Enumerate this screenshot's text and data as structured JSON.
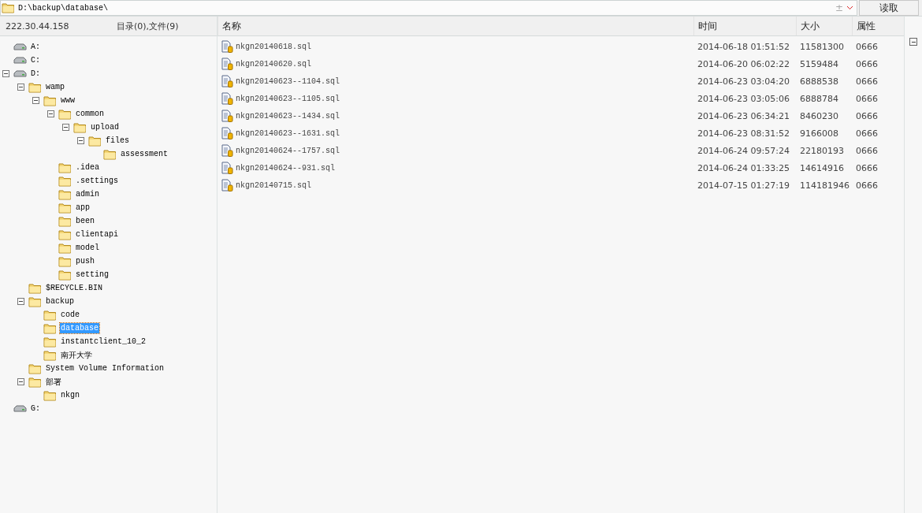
{
  "path_bar": {
    "value": "D:\\backup\\database\\",
    "plus": "±",
    "button": "读取"
  },
  "tree_header": {
    "host": "222.30.44.158",
    "counts": "目录(0),文件(9)"
  },
  "tree": [
    {
      "label": "A:",
      "kind": "drive",
      "selected": false
    },
    {
      "label": "C:",
      "kind": "drive",
      "selected": false
    },
    {
      "label": "D:",
      "kind": "drive",
      "selected": false,
      "expanded": true,
      "children": [
        {
          "label": "wamp",
          "kind": "folder",
          "selected": false,
          "expanded": true,
          "children": [
            {
              "label": "www",
              "kind": "folder",
              "selected": false,
              "expanded": true,
              "children": [
                {
                  "label": "common",
                  "kind": "folder",
                  "selected": false,
                  "expanded": true,
                  "children": [
                    {
                      "label": "upload",
                      "kind": "folder",
                      "selected": false,
                      "expanded": true,
                      "children": [
                        {
                          "label": "files",
                          "kind": "folder",
                          "selected": false,
                          "expanded": true,
                          "children": [
                            {
                              "label": "assessment",
                              "kind": "folder",
                              "selected": false
                            }
                          ]
                        }
                      ]
                    }
                  ]
                },
                {
                  "label": ".idea",
                  "kind": "folder",
                  "selected": false
                },
                {
                  "label": ".settings",
                  "kind": "folder",
                  "selected": false
                },
                {
                  "label": "admin",
                  "kind": "folder",
                  "selected": false
                },
                {
                  "label": "app",
                  "kind": "folder",
                  "selected": false
                },
                {
                  "label": "been",
                  "kind": "folder",
                  "selected": false
                },
                {
                  "label": "clientapi",
                  "kind": "folder",
                  "selected": false
                },
                {
                  "label": "model",
                  "kind": "folder",
                  "selected": false
                },
                {
                  "label": "push",
                  "kind": "folder",
                  "selected": false
                },
                {
                  "label": "setting",
                  "kind": "folder",
                  "selected": false
                }
              ]
            }
          ]
        },
        {
          "label": "$RECYCLE.BIN",
          "kind": "folder",
          "selected": false
        },
        {
          "label": "backup",
          "kind": "folder",
          "selected": false,
          "expanded": true,
          "children": [
            {
              "label": "code",
              "kind": "folder",
              "selected": false
            },
            {
              "label": "database",
              "kind": "folder",
              "selected": true
            },
            {
              "label": "instantclient_10_2",
              "kind": "folder",
              "selected": false
            },
            {
              "label": "南开大学",
              "kind": "folder",
              "selected": false
            }
          ]
        },
        {
          "label": "System Volume Information",
          "kind": "folder",
          "selected": false
        },
        {
          "label": "部署",
          "kind": "folder",
          "selected": false,
          "expanded": true,
          "children": [
            {
              "label": "nkgn",
              "kind": "folder",
              "selected": false
            }
          ]
        }
      ]
    },
    {
      "label": "G:",
      "kind": "drive",
      "selected": false
    }
  ],
  "table": {
    "columns": [
      "名称",
      "时间",
      "大小",
      "属性"
    ],
    "rows": [
      [
        "nkgn20140618.sql",
        "2014-06-18 01:51:52",
        "11581300",
        "0666"
      ],
      [
        "nkgn20140620.sql",
        "2014-06-20 06:02:22",
        "5159484",
        "0666"
      ],
      [
        "nkgn20140623--1104.sql",
        "2014-06-23 03:04:20",
        "6888538",
        "0666"
      ],
      [
        "nkgn20140623--1105.sql",
        "2014-06-23 03:05:06",
        "6888784",
        "0666"
      ],
      [
        "nkgn20140623--1434.sql",
        "2014-06-23 06:34:21",
        "8460230",
        "0666"
      ],
      [
        "nkgn20140623--1631.sql",
        "2014-06-23 08:31:52",
        "9166008",
        "0666"
      ],
      [
        "nkgn20140624--1757.sql",
        "2014-06-24 09:57:24",
        "22180193",
        "0666"
      ],
      [
        "nkgn20140624--931.sql",
        "2014-06-24 01:33:25",
        "14614916",
        "0666"
      ],
      [
        "nkgn20140715.sql",
        "2014-07-15 01:27:19",
        "114181946",
        "0666"
      ]
    ]
  }
}
